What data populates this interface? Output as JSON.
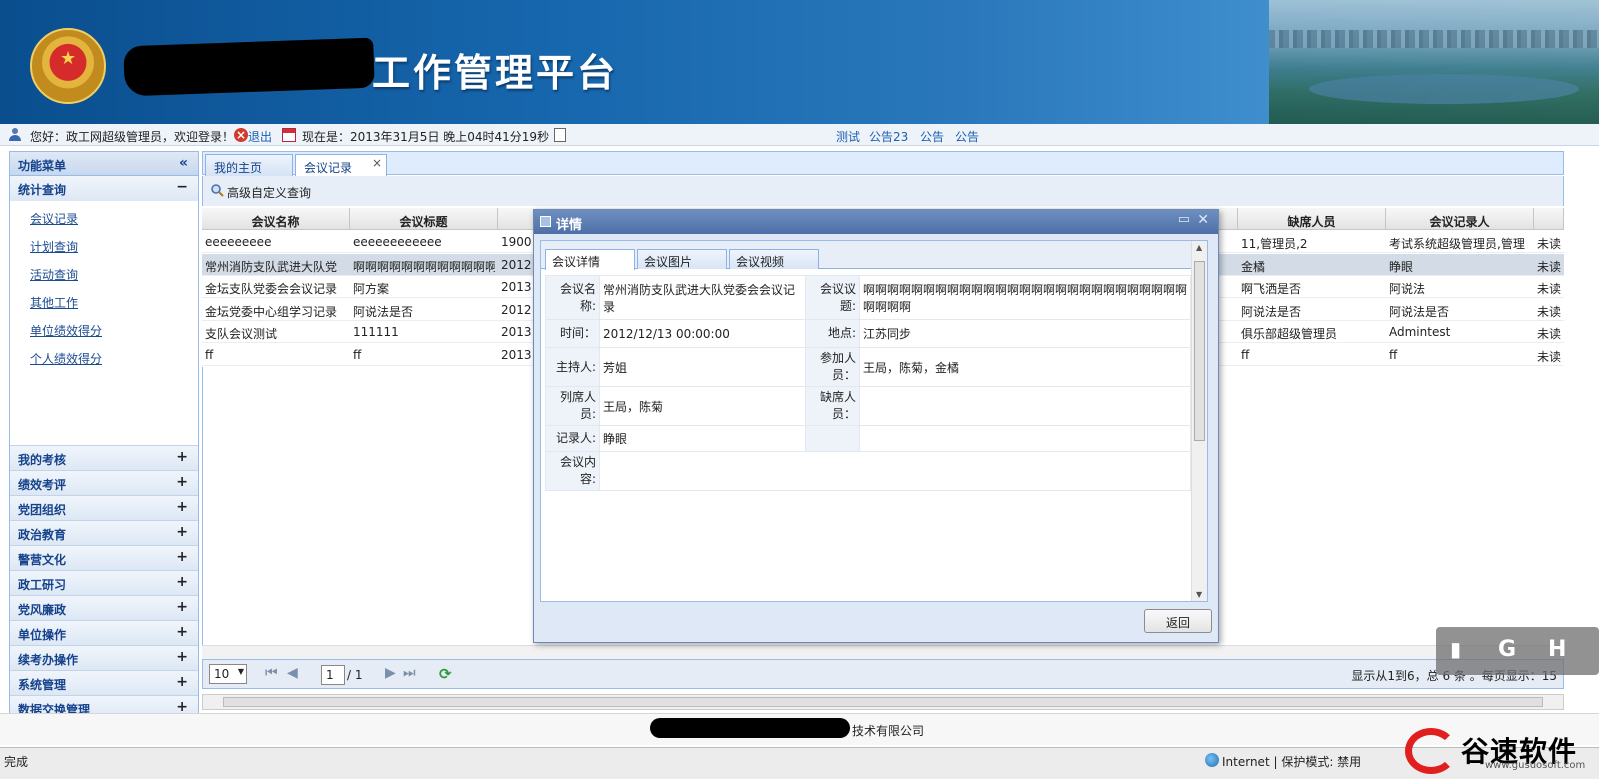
{
  "header": {
    "title": "工作管理平台"
  },
  "infobar": {
    "greeting": "您好：政工网超级管理员，欢迎登录！",
    "logout": "退出",
    "now": "现在是：2013年31月5日 晚上04时41分19秒",
    "notices": [
      "测试",
      "公告23",
      "公告",
      "公告"
    ]
  },
  "menu": {
    "head": "功能菜单",
    "collapse_icon": "«",
    "open_group": {
      "label": "统计查询",
      "toggle": "−"
    },
    "sub_items": [
      "会议记录",
      "计划查询",
      "活动查询",
      "其他工作",
      "单位绩效得分",
      "个人绩效得分"
    ],
    "groups": [
      "我的考核",
      "绩效考评",
      "党团组织",
      "政治教育",
      "警营文化",
      "政工研习",
      "党风廉政",
      "单位操作",
      "续考办操作",
      "系统管理",
      "数据交换管理"
    ],
    "group_toggle": "+"
  },
  "tabs": [
    {
      "label": "我的主页"
    },
    {
      "label": "会议记录",
      "close": "×"
    }
  ],
  "toolbar": {
    "query_label": "高级自定义查询"
  },
  "grid": {
    "headers_left": [
      "会议名称",
      "会议标题"
    ],
    "headers_right": [
      "缺席人员",
      "会议记录人"
    ],
    "rows": [
      {
        "name": "eeeeeeeee",
        "title": "eeeeeeeeeeee",
        "date": "1900/",
        "absent": "11,管理员,2",
        "recorder": "考试系统超级管理员,管理",
        "status": "未读"
      },
      {
        "name": "常州消防支队武进大队党",
        "title": "啊啊啊啊啊啊啊啊啊啊啊啊",
        "date": "2012/",
        "absent": "金橘",
        "recorder": "睁眼",
        "status": "未读"
      },
      {
        "name": "金坛支队党委会会议记录",
        "title": "阿方案",
        "date": "2013/",
        "absent": "啊飞洒是否",
        "recorder": "阿说法",
        "status": "未读"
      },
      {
        "name": "金坛党委中心组学习记录",
        "title": "阿说法是否",
        "date": "2012/",
        "absent": "阿说法是否",
        "recorder": "阿说法是否",
        "status": "未读"
      },
      {
        "name": "支队会议测试",
        "title": "111111",
        "date": "2013/",
        "absent": "俱乐部超级管理员",
        "recorder": "Admintest",
        "status": "未读"
      },
      {
        "name": "ff",
        "title": "ff",
        "date": "2013/",
        "absent": "ff",
        "recorder": "ff",
        "status": "未读"
      }
    ],
    "selected_row": 1
  },
  "pager": {
    "page_size": "10",
    "page": "1",
    "total_pages": "/ 1",
    "info": "显示从1到6，总 6 条 。每页显示：15"
  },
  "dialog": {
    "title": "详情",
    "tabs": [
      "会议详情",
      "会议图片",
      "会议视频"
    ],
    "fields": {
      "name_label": "会议名称:",
      "name_value": "常州消防支队武进大队党委会会议记录",
      "topic_label": "会议议题:",
      "topic_value": "啊啊啊啊啊啊啊啊啊啊啊啊啊啊啊啊啊啊啊啊啊啊啊啊啊啊啊啊啊啊啊",
      "time_label": "时间：",
      "time_value": "2012/12/13 00:00:00",
      "place_label": "地点:",
      "place_value": "江苏同步",
      "host_label": "主持人:",
      "host_value": "芳姐",
      "participants_label": "参加人员：",
      "participants_value": "王局，陈菊，金橘",
      "attendees_label": "列席人员:",
      "attendees_value": "王局，陈菊",
      "absent_label": "缺席人员：",
      "absent_value": "",
      "recorder_label": "记录人:",
      "recorder_value": "睁眼",
      "content_label": "会议内容:",
      "content_value": ""
    },
    "back_button": "返回"
  },
  "footer": {
    "copyright": "技术有限公司"
  },
  "statusbar": {
    "left": "完成",
    "right": "Internet | 保护模式: 禁用"
  },
  "watermark": {
    "badge_letters": [
      "G",
      "H"
    ],
    "brand": "谷速软件",
    "url": "www.gusuosoft.com"
  }
}
